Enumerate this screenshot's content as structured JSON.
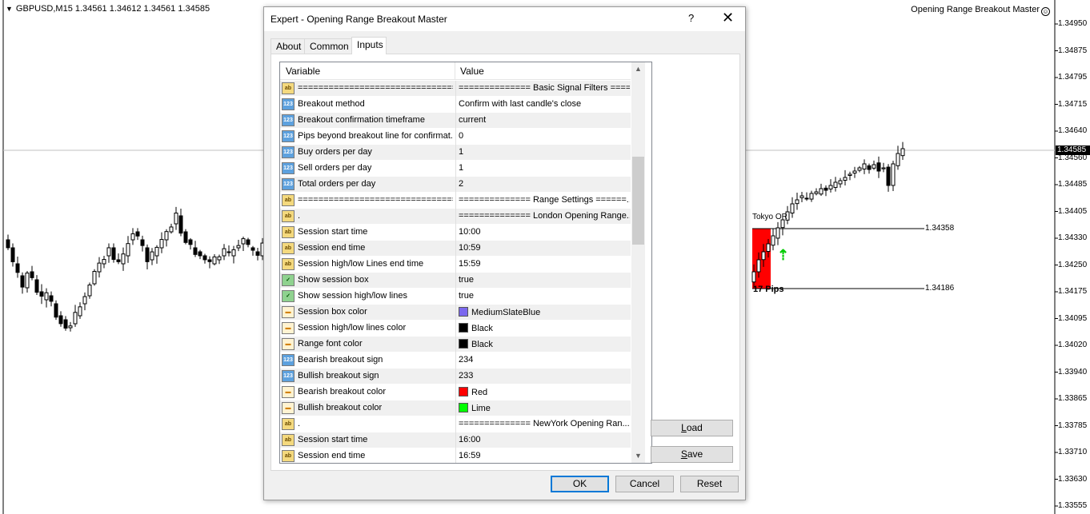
{
  "chart": {
    "symbol_header": "GBPUSD,M15  1.34561 1.34612 1.34561 1.34585",
    "ea_label": "Opening Range Breakout Master",
    "current_price": "1.34585",
    "price_axis": [
      "1.34950",
      "1.34875",
      "1.34795",
      "1.34715",
      "1.34640",
      "1.34560",
      "1.34485",
      "1.34405",
      "1.34330",
      "1.34250",
      "1.34175",
      "1.34095",
      "1.34020",
      "1.33940",
      "1.33865",
      "1.33785",
      "1.33710",
      "1.33630",
      "1.33555"
    ],
    "range_label": "Tokyo OR",
    "range_high": "1.34358",
    "range_low": "1.34186",
    "range_pips": "17 Pips",
    "colors": {
      "range_box": "#ff0000",
      "bullish_arrow": "#00ff00",
      "price_tag_bg": "#000000"
    }
  },
  "dialog": {
    "title": "Expert - Opening Range Breakout Master",
    "help": "?",
    "close": "✕",
    "tabs": [
      {
        "label": "About",
        "active": false
      },
      {
        "label": "Common",
        "active": false
      },
      {
        "label": "Inputs",
        "active": true
      }
    ],
    "columns": {
      "variable": "Variable",
      "value": "Value"
    },
    "rows": [
      {
        "icon": "ab",
        "variable": "================================",
        "value": "============== Basic Signal Filters ====..."
      },
      {
        "icon": "123",
        "variable": "Breakout method",
        "value": "Confirm with last candle's close"
      },
      {
        "icon": "123",
        "variable": "Breakout confirmation timeframe",
        "value": "current"
      },
      {
        "icon": "123",
        "variable": "Pips beyond breakout line for confirmat...",
        "value": "0"
      },
      {
        "icon": "123",
        "variable": "Buy orders per day",
        "value": "1"
      },
      {
        "icon": "123",
        "variable": "Sell orders per day",
        "value": "1"
      },
      {
        "icon": "123",
        "variable": "Total orders per day",
        "value": "2"
      },
      {
        "icon": "ab",
        "variable": "================================",
        "value": "============== Range Settings ======..."
      },
      {
        "icon": "ab",
        "variable": ".",
        "value": "============== London Opening Range..."
      },
      {
        "icon": "ab",
        "variable": "Session start time",
        "value": "10:00"
      },
      {
        "icon": "ab",
        "variable": "Session end time",
        "value": "10:59"
      },
      {
        "icon": "ab",
        "variable": "Session high/low Lines end time",
        "value": "15:59"
      },
      {
        "icon": "bool",
        "variable": "Show session box",
        "value": "true"
      },
      {
        "icon": "bool",
        "variable": "Show session high/low lines",
        "value": "true"
      },
      {
        "icon": "color",
        "variable": "Session box color",
        "value": "MediumSlateBlue",
        "swatch": "#7b68ee"
      },
      {
        "icon": "color",
        "variable": "Session high/low lines color",
        "value": "Black",
        "swatch": "#000000"
      },
      {
        "icon": "color",
        "variable": "Range font color",
        "value": "Black",
        "swatch": "#000000"
      },
      {
        "icon": "123",
        "variable": "Bearish breakout sign",
        "value": "234"
      },
      {
        "icon": "123",
        "variable": "Bullish breakout sign",
        "value": "233"
      },
      {
        "icon": "color",
        "variable": "Bearish breakout color",
        "value": "Red",
        "swatch": "#ff0000"
      },
      {
        "icon": "color",
        "variable": "Bullish breakout color",
        "value": "Lime",
        "swatch": "#00ff00"
      },
      {
        "icon": "ab",
        "variable": ".",
        "value": "============== NewYork Opening Ran..."
      },
      {
        "icon": "ab",
        "variable": "Session start time",
        "value": "16:00"
      },
      {
        "icon": "ab",
        "variable": "Session end time",
        "value": "16:59"
      }
    ],
    "scroll_up": "▲",
    "scroll_down": "▼",
    "buttons": {
      "load_u": "L",
      "load_rest": "oad",
      "save_u": "S",
      "save_rest": "ave",
      "ok": "OK",
      "cancel": "Cancel",
      "reset": "Reset"
    }
  }
}
